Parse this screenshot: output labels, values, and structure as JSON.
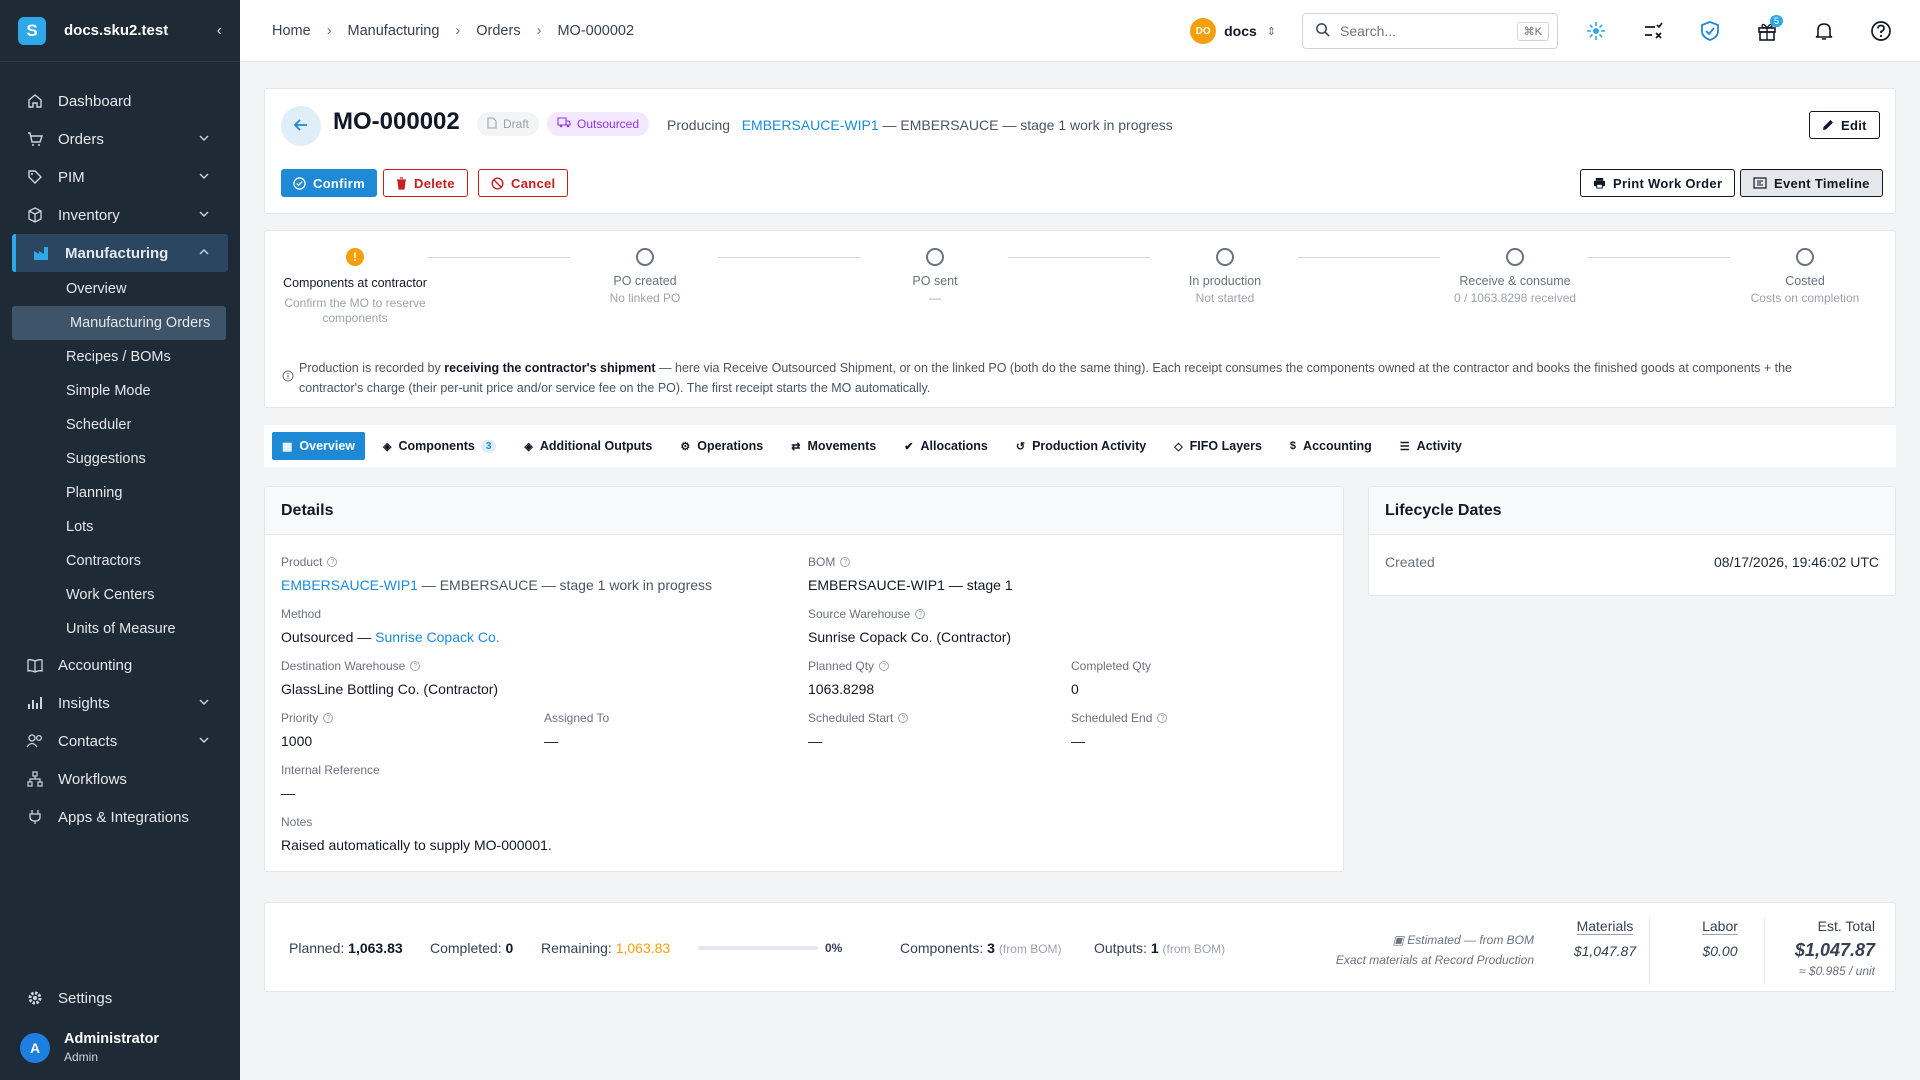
{
  "sidebar": {
    "org": "docs.sku2.test",
    "logo": "S",
    "items": [
      {
        "label": "Dashboard"
      },
      {
        "label": "Orders"
      },
      {
        "label": "PIM"
      },
      {
        "label": "Inventory"
      },
      {
        "label": "Manufacturing"
      },
      {
        "label": "Accounting"
      },
      {
        "label": "Insights"
      },
      {
        "label": "Contacts"
      },
      {
        "label": "Workflows"
      },
      {
        "label": "Apps & Integrations"
      }
    ],
    "manufacturing_sub": [
      "Overview",
      "Manufacturing Orders",
      "Recipes / BOMs",
      "Simple Mode",
      "Scheduler",
      "Suggestions",
      "Planning",
      "Lots",
      "Contractors",
      "Work Centers",
      "Units of Measure"
    ],
    "settings": "Settings",
    "user": {
      "initial": "A",
      "name": "Administrator",
      "role": "Admin"
    }
  },
  "topbar": {
    "breadcrumb": [
      "Home",
      "Manufacturing",
      "Orders",
      "MO-000002"
    ],
    "org_initials": "DO",
    "org_name": "docs",
    "search_placeholder": "Search...",
    "search_shortcut": "⌘K",
    "gift_count": "5"
  },
  "order": {
    "number": "MO-000002",
    "status": "Draft",
    "method_badge": "Outsourced",
    "producing_label": "Producing",
    "product_sku": "EMBERSAUCE-WIP1",
    "product_desc": "— EMBERSAUCE — stage 1 work in progress",
    "buttons": {
      "confirm": "Confirm",
      "delete": "Delete",
      "cancel": "Cancel",
      "edit": "Edit",
      "print": "Print Work Order",
      "timeline": "Event Timeline"
    }
  },
  "stepper": {
    "steps": [
      {
        "label": "Components at contractor",
        "sub": "Confirm the MO to reserve components"
      },
      {
        "label": "PO created",
        "sub": "No linked PO"
      },
      {
        "label": "PO sent",
        "sub": "—"
      },
      {
        "label": "In production",
        "sub": "Not started"
      },
      {
        "label": "Receive & consume",
        "sub": "0 / 1063.8298 received"
      },
      {
        "label": "Costed",
        "sub": "Costs on completion"
      }
    ],
    "info_pre": "Production is recorded by ",
    "info_bold": "receiving the contractor's shipment",
    "info_post": " — here via Receive Outsourced Shipment, or on the linked PO (both do the same thing). Each receipt consumes the components owned at the contractor and books the finished goods at components + the contractor's charge (their per-unit price and/or service fee on the PO). The first receipt starts the MO automatically."
  },
  "tabs": [
    {
      "label": "Overview"
    },
    {
      "label": "Components",
      "count": "3"
    },
    {
      "label": "Additional Outputs"
    },
    {
      "label": "Operations"
    },
    {
      "label": "Movements"
    },
    {
      "label": "Allocations"
    },
    {
      "label": "Production Activity"
    },
    {
      "label": "FIFO Layers"
    },
    {
      "label": "Accounting"
    },
    {
      "label": "Activity"
    }
  ],
  "details": {
    "title": "Details",
    "product_label": "Product",
    "product_link": "EMBERSAUCE-WIP1",
    "product_rest": " — EMBERSAUCE — stage 1 work in progress",
    "bom_label": "BOM",
    "bom_value": "EMBERSAUCE-WIP1 — stage 1",
    "method_label": "Method",
    "method_prefix": "Outsourced — ",
    "method_link": "Sunrise Copack Co.",
    "source_wh_label": "Source Warehouse",
    "source_wh_value": "Sunrise Copack Co. (Contractor)",
    "dest_wh_label": "Destination Warehouse",
    "dest_wh_value": "GlassLine Bottling Co. (Contractor)",
    "planned_label": "Planned Qty",
    "planned_value": "1063.8298",
    "completed_label": "Completed Qty",
    "completed_value": "0",
    "priority_label": "Priority",
    "priority_value": "1000",
    "assigned_label": "Assigned To",
    "assigned_value": "—",
    "sched_start_label": "Scheduled Start",
    "sched_start_value": "—",
    "sched_end_label": "Scheduled End",
    "sched_end_value": "—",
    "internal_ref_label": "Internal Reference",
    "internal_ref_value": "—",
    "notes_label": "Notes",
    "notes_value": "Raised automatically to supply MO-000001."
  },
  "lifecycle": {
    "title": "Lifecycle Dates",
    "created_label": "Created",
    "created_value": "08/17/2026, 19:46:02 UTC"
  },
  "summary": {
    "planned_label": "Planned:",
    "planned_value": "1,063.83",
    "completed_label": "Completed:",
    "completed_value": "0",
    "remaining_label": "Remaining:",
    "remaining_value": "1,063.83",
    "progress_pct": "0%",
    "progress_fraction": 0,
    "components_label": "Components:",
    "components_value": "3",
    "components_note": "(from BOM)",
    "outputs_label": "Outputs:",
    "outputs_value": "1",
    "outputs_note": "(from BOM)",
    "estimated_line1": "Estimated — from BOM",
    "estimated_line2": "Exact materials at Record Production",
    "materials_label": "Materials",
    "materials_value": "$1,047.87",
    "labor_label": "Labor",
    "labor_value": "$0.00",
    "total_label": "Est. Total",
    "total_value": "$1,047.87",
    "per_unit": "≈ $0.985 / unit"
  },
  "colors": {
    "accent": "#1e8ad6",
    "sidebar": "#1f2a37",
    "danger": "#c81e1e",
    "warning": "#f59e0b",
    "outsourced": "#9333ea"
  }
}
